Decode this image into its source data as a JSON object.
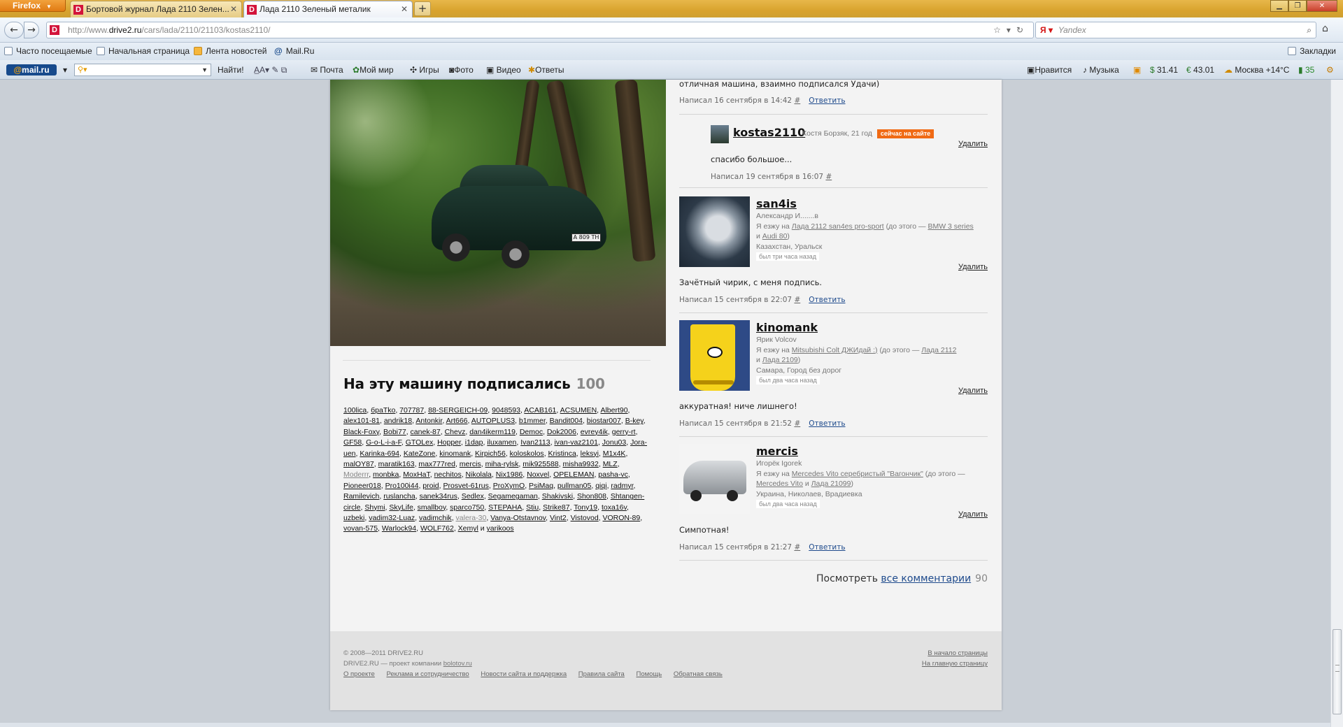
{
  "browser": {
    "firefox_button": "Firefox",
    "tabs": [
      {
        "title": "Бортовой журнал Лада 2110 Зелен...",
        "active": false
      },
      {
        "title": "Лада 2110 Зеленый металик",
        "active": true
      }
    ],
    "url_prefix": "http://www.",
    "url_host": "drive2.ru",
    "url_path": "/cars/lada/2110/21103/kostas2110/",
    "search_placeholder": "Yandex",
    "bookmarks_right": "Закладки",
    "bookmarks": [
      "Часто посещаемые",
      "Начальная страница",
      "Лента новостей",
      "Mail.Ru"
    ]
  },
  "mailbar": {
    "find": "Найти!",
    "items": [
      "Почта",
      "Мой мир",
      "Игры",
      "Фото",
      "Видео",
      "Ответы"
    ],
    "right": [
      "Нравится",
      "Музыка",
      "31.41",
      "43.01",
      "Москва +14°C",
      "35"
    ]
  },
  "subscribers": {
    "title": "На эту машину подписались",
    "count": "100",
    "names": [
      "100lica",
      "бpaTko",
      "707787",
      "88-SERGEICH-09",
      "9048593",
      "ACAB161",
      "ACSUMEN",
      "Albert90",
      "alex101-81",
      "andrik18",
      "Antonkir",
      "Art666",
      "AUTOPLUS3",
      "b1mmer",
      "Bandit004",
      "biostar007",
      "B-key",
      "Black-Foxy",
      "Bobi77",
      "canek-87",
      "Chevz",
      "dan4ikerm119",
      "Democ",
      "Dok2006",
      "evrey4ik",
      "gerry-rt",
      "GF58",
      "G-o-L-i-a-F",
      "GTOLex",
      "Hopper",
      "i1dap",
      "iluxamen",
      "Ivan2113",
      "ivan-vaz2101",
      "Jonu03",
      "Jora-uen",
      "Karinka-694",
      "KateZone",
      "kinomank",
      "Kirpich56",
      "koloskolos",
      "Kristinca",
      "leksyi",
      "M1x4K",
      "malOY87",
      "maratik163",
      "max777red",
      "mercis",
      "miha-rylsk",
      "mik925588",
      "misha9932",
      "MLZ",
      "Moderrr",
      "monbka",
      "MoxHaT",
      "nechitos",
      "Nikolala",
      "Nix1986",
      "Noxvel",
      "OPELEMAN",
      "pasha-vc",
      "Pioneer018",
      "Pro100i44",
      "proid",
      "Prosvet-61rus",
      "ProXymO",
      "PsiMaq",
      "pullman05",
      "qiqi",
      "radmyr",
      "Ramilevich",
      "ruslancha",
      "sanek34rus",
      "Sedlex",
      "Segamegaman",
      "Shakivski",
      "Shon808",
      "Shtangen-circle",
      "Shymi",
      "SkyLife",
      "smallboy",
      "sparco750",
      "STEPAHA",
      "Stiu",
      "Strike87",
      "Tony19",
      "toxa16v",
      "uzbeki",
      "vadim32-Luaz",
      "vadimchik",
      "valera-30",
      "Vanya-Otstavnov",
      "Vint2",
      "Vistovod",
      "VORON-89",
      "vovan-575",
      "Warlock94",
      "WOLF762",
      "Xemyl",
      "yarikoos"
    ],
    "grey": [
      "Moderrr",
      "valera-30"
    ],
    "and": "и"
  },
  "comments": {
    "c0": {
      "text": "отличная машина, взаимно подписался Удачи)",
      "meta": "Написал 16 сентября в 14:42",
      "hash": "#",
      "reply": "Ответить"
    },
    "c1": {
      "user": "kostas2110",
      "info": "Костя Борзяк, 21 год",
      "badge": "сейчас на сайте",
      "delete": "Удалить",
      "text": "спасибо большое...",
      "meta": "Написал 19 сентября в 16:07",
      "hash": "#"
    },
    "c2": {
      "user": "san4is",
      "name": "Александр И.......в",
      "drives_pre": "Я езжу на",
      "car": "Лада 2112 san4es pro-sport",
      "before": "(до этого —",
      "car2": "BMW 3 series",
      "and": "и",
      "car3": "Audi 80",
      "close": ")",
      "location": "Казахстан, Уральск",
      "ago": "был три часа назад",
      "delete": "Удалить",
      "text": "Зачётный чирик, с меня подпись.",
      "meta": "Написал 15 сентября в 22:07",
      "hash": "#",
      "reply": "Ответить"
    },
    "c3": {
      "user": "kinomank",
      "name": "Ярик Volcov",
      "drives_pre": "Я езжу на",
      "car": "Mitsubishi Colt ДЖИдай :)",
      "before": "(до этого —",
      "car2": "Лада 2112",
      "and": "и",
      "car3": "Лада 2109",
      "close": ")",
      "location": "Самара, Город без дорог",
      "ago": "был два часа назад",
      "delete": "Удалить",
      "text": "аккуратная! ниче лишнего!",
      "meta": "Написал 15 сентября в 21:52",
      "hash": "#",
      "reply": "Ответить"
    },
    "c4": {
      "user": "mercis",
      "name": "Игорёк Igorek",
      "drives_pre": "Я езжу на",
      "car": "Mercedes Vito серебристый \"Вагончик\"",
      "before": "(до этого —",
      "car2": "Mercedes Vito",
      "and": "и",
      "car3": "Лада 21099",
      "close": ")",
      "location": "Украина, Николаев, Врадиевка",
      "ago": "был два часа назад",
      "delete": "Удалить",
      "text": "Симпотная!",
      "meta": "Написал 15 сентября в 21:27",
      "hash": "#",
      "reply": "Ответить"
    }
  },
  "all_comments": {
    "prefix": "Посмотреть",
    "link": "все комментарии",
    "count": "90"
  },
  "footer": {
    "copyright": "© 2008—2011 DRIVE2.RU",
    "project": "DRIVE2.RU — проект компании",
    "company": "bolotov.ru",
    "links": [
      "О проекте",
      "Реклама и сотрудничество",
      "Новости сайта и поддержка",
      "Правила сайта",
      "Помощь",
      "Обратная связь"
    ],
    "to_top": "В начало страницы",
    "to_home": "На главную страницу"
  },
  "plate": "A 809 TH"
}
